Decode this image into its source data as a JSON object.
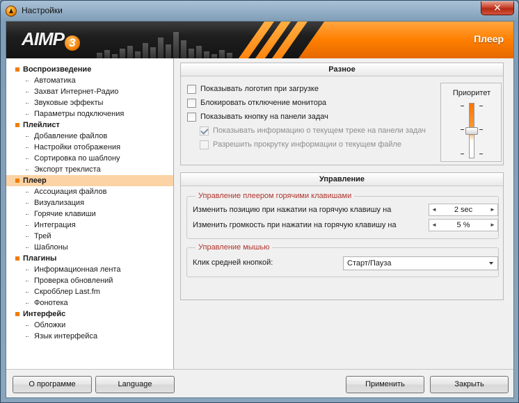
{
  "window": {
    "title": "Настройки",
    "close_glyph": "✕",
    "icon": "aimp-app-icon"
  },
  "banner": {
    "logo_text": "AIMP",
    "logo_version": "3",
    "section_title": "Плеер",
    "accent_color": "#ff7f00"
  },
  "sidebar": {
    "items": [
      {
        "label": "Воспроизведение",
        "kind": "group"
      },
      {
        "label": "Автоматика",
        "kind": "child"
      },
      {
        "label": "Захват Интернет-Радио",
        "kind": "child"
      },
      {
        "label": "Звуковые эффекты",
        "kind": "child"
      },
      {
        "label": "Параметры подключения",
        "kind": "child"
      },
      {
        "label": "Плейлист",
        "kind": "group"
      },
      {
        "label": "Добавление файлов",
        "kind": "child"
      },
      {
        "label": "Настройки отображения",
        "kind": "child"
      },
      {
        "label": "Сортировка по шаблону",
        "kind": "child"
      },
      {
        "label": "Экспорт треклиста",
        "kind": "child"
      },
      {
        "label": "Плеер",
        "kind": "group",
        "selected": true
      },
      {
        "label": "Ассоциация файлов",
        "kind": "child"
      },
      {
        "label": "Визуализация",
        "kind": "child"
      },
      {
        "label": "Горячие клавиши",
        "kind": "child"
      },
      {
        "label": "Интеграция",
        "kind": "child"
      },
      {
        "label": "Трей",
        "kind": "child"
      },
      {
        "label": "Шаблоны",
        "kind": "child"
      },
      {
        "label": "Плагины",
        "kind": "group"
      },
      {
        "label": "Информационная лента",
        "kind": "child"
      },
      {
        "label": "Проверка обновлений",
        "kind": "child"
      },
      {
        "label": "Скробблер Last.fm",
        "kind": "child"
      },
      {
        "label": "Фонотека",
        "kind": "child"
      },
      {
        "label": "Интерфейс",
        "kind": "group"
      },
      {
        "label": "Обложки",
        "kind": "child"
      },
      {
        "label": "Язык интерфейса",
        "kind": "child"
      }
    ],
    "selected_color": "#fcd3a5"
  },
  "misc": {
    "title": "Разное",
    "checkboxes": [
      {
        "label": "Показывать логотип при загрузке",
        "checked": false,
        "enabled": true
      },
      {
        "label": "Блокировать отключение монитора",
        "checked": false,
        "enabled": true
      },
      {
        "label": "Показывать кнопку на панели задач",
        "checked": false,
        "enabled": true
      },
      {
        "label": "Показывать информацию о текущем треке на панели задач",
        "checked": true,
        "enabled": false
      },
      {
        "label": "Разрешить прокрутку информации о текущем файле",
        "checked": false,
        "enabled": false
      }
    ],
    "priority": {
      "label": "Приоритет",
      "level": 0.5
    }
  },
  "control": {
    "title": "Управление",
    "hotkeys_group": {
      "legend": "Управление плеером горячими клавишами",
      "rows": [
        {
          "label": "Изменить позицию при нажатии на горячую клавишу на",
          "value": "2 sec"
        },
        {
          "label": "Изменить громкость при нажатии на горячую клавишу на",
          "value": "5 %"
        }
      ]
    },
    "mouse_group": {
      "legend": "Управление мышью",
      "label": "Клик средней кнопкой:",
      "selected": "Старт/Пауза"
    },
    "legend_color": "#b0342d"
  },
  "footer": {
    "about": "О программе",
    "language": "Language",
    "apply": "Применить",
    "close": "Закрыть"
  }
}
